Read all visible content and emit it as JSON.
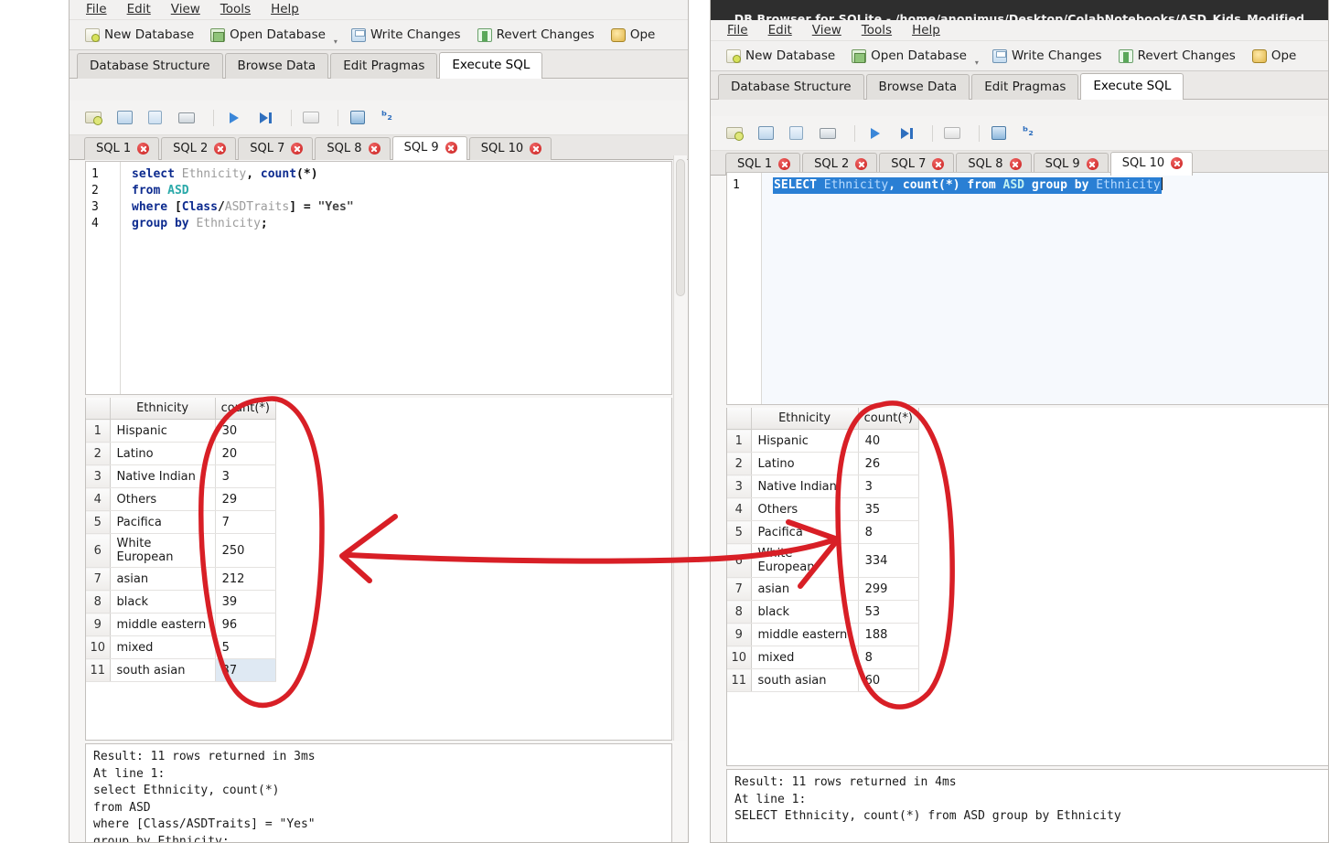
{
  "left_window": {
    "menu": [
      {
        "label": "File",
        "accel": "F"
      },
      {
        "label": "Edit",
        "accel": "E"
      },
      {
        "label": "View",
        "accel": "V"
      },
      {
        "label": "Tools",
        "accel": "T"
      },
      {
        "label": "Help",
        "accel": "H"
      }
    ],
    "toolbar": [
      {
        "label": "New Database",
        "icon": "new-database-icon"
      },
      {
        "label": "Open Database",
        "icon": "open-database-icon"
      },
      {
        "label": "Write Changes",
        "icon": "write-changes-icon"
      },
      {
        "label": "Revert Changes",
        "icon": "revert-changes-icon"
      },
      {
        "label": "Ope",
        "icon": "open-project-icon"
      }
    ],
    "main_tabs": [
      {
        "label": "Database Structure",
        "active": false
      },
      {
        "label": "Browse Data",
        "active": false
      },
      {
        "label": "Edit Pragmas",
        "active": false
      },
      {
        "label": "Execute SQL",
        "active": true
      }
    ],
    "sql_tabs": [
      {
        "label": "SQL 1",
        "active": false
      },
      {
        "label": "SQL 2",
        "active": false
      },
      {
        "label": "SQL 7",
        "active": false
      },
      {
        "label": "SQL 8",
        "active": false
      },
      {
        "label": "SQL 9",
        "active": true
      },
      {
        "label": "SQL 10",
        "active": false
      }
    ],
    "editor": {
      "line_numbers": [
        "1",
        "2",
        "3",
        "4"
      ],
      "lines": [
        "select Ethnicity, count(*)",
        "from ASD",
        "where [Class/ASDTraits] = \"Yes\"",
        "group by Ethnicity;"
      ]
    },
    "results": {
      "columns": [
        "Ethnicity",
        "count(*)"
      ],
      "rows": [
        {
          "n": "1",
          "ethnicity": "Hispanic",
          "count": "30"
        },
        {
          "n": "2",
          "ethnicity": "Latino",
          "count": "20"
        },
        {
          "n": "3",
          "ethnicity": "Native Indian",
          "count": "3"
        },
        {
          "n": "4",
          "ethnicity": "Others",
          "count": "29"
        },
        {
          "n": "5",
          "ethnicity": "Pacifica",
          "count": "7"
        },
        {
          "n": "6",
          "ethnicity": "White European",
          "count": "250"
        },
        {
          "n": "7",
          "ethnicity": "asian",
          "count": "212"
        },
        {
          "n": "8",
          "ethnicity": "black",
          "count": "39"
        },
        {
          "n": "9",
          "ethnicity": "middle eastern",
          "count": "96"
        },
        {
          "n": "10",
          "ethnicity": "mixed",
          "count": "5"
        },
        {
          "n": "11",
          "ethnicity": "south asian",
          "count": "37"
        }
      ],
      "selected_row_index": 10
    },
    "log": "Result: 11 rows returned in 3ms\nAt line 1:\nselect Ethnicity, count(*)\nfrom ASD\nwhere [Class/ASDTraits] = \"Yes\"\ngroup by Ethnicity;"
  },
  "right_window": {
    "title": "DB Browser for SQLite - /home/anonimus/Desktop/ColabNotebooks/ASD_Kids_Modified",
    "menu": [
      {
        "label": "File",
        "accel": "F"
      },
      {
        "label": "Edit",
        "accel": "E"
      },
      {
        "label": "View",
        "accel": "V"
      },
      {
        "label": "Tools",
        "accel": "T"
      },
      {
        "label": "Help",
        "accel": "H"
      }
    ],
    "toolbar": [
      {
        "label": "New Database",
        "icon": "new-database-icon"
      },
      {
        "label": "Open Database",
        "icon": "open-database-icon"
      },
      {
        "label": "Write Changes",
        "icon": "write-changes-icon"
      },
      {
        "label": "Revert Changes",
        "icon": "revert-changes-icon"
      },
      {
        "label": "Ope",
        "icon": "open-project-icon"
      }
    ],
    "main_tabs": [
      {
        "label": "Database Structure",
        "active": false
      },
      {
        "label": "Browse Data",
        "active": false
      },
      {
        "label": "Edit Pragmas",
        "active": false
      },
      {
        "label": "Execute SQL",
        "active": true
      }
    ],
    "sql_tabs": [
      {
        "label": "SQL 1",
        "active": false
      },
      {
        "label": "SQL 2",
        "active": false
      },
      {
        "label": "SQL 7",
        "active": false
      },
      {
        "label": "SQL 8",
        "active": false
      },
      {
        "label": "SQL 9",
        "active": false
      },
      {
        "label": "SQL 10",
        "active": true
      }
    ],
    "editor": {
      "line_numbers": [
        "1"
      ],
      "lines": [
        "SELECT Ethnicity, count(*) from ASD group by Ethnicity"
      ],
      "selected": true
    },
    "results": {
      "columns": [
        "Ethnicity",
        "count(*)"
      ],
      "rows": [
        {
          "n": "1",
          "ethnicity": "Hispanic",
          "count": "40"
        },
        {
          "n": "2",
          "ethnicity": "Latino",
          "count": "26"
        },
        {
          "n": "3",
          "ethnicity": "Native Indian",
          "count": "3"
        },
        {
          "n": "4",
          "ethnicity": "Others",
          "count": "35"
        },
        {
          "n": "5",
          "ethnicity": "Pacifica",
          "count": "8"
        },
        {
          "n": "6",
          "ethnicity": "White European",
          "count": "334"
        },
        {
          "n": "7",
          "ethnicity": "asian",
          "count": "299"
        },
        {
          "n": "8",
          "ethnicity": "black",
          "count": "53"
        },
        {
          "n": "9",
          "ethnicity": "middle eastern",
          "count": "188"
        },
        {
          "n": "10",
          "ethnicity": "mixed",
          "count": "8"
        },
        {
          "n": "11",
          "ethnicity": "south asian",
          "count": "60"
        }
      ],
      "selected_row_index": -1
    },
    "log": "Result: 11 rows returned in 4ms\nAt line 1:\nSELECT Ethnicity, count(*) from ASD group by Ethnicity"
  },
  "annotations": {
    "ink_color": "#d81f26",
    "left_ellipse": "hand-drawn red ellipse around left count(*) column",
    "right_ellipse": "hand-drawn red ellipse around right count(*) column",
    "arrow": "double-headed red arrow pointing between the two count(*) columns"
  }
}
